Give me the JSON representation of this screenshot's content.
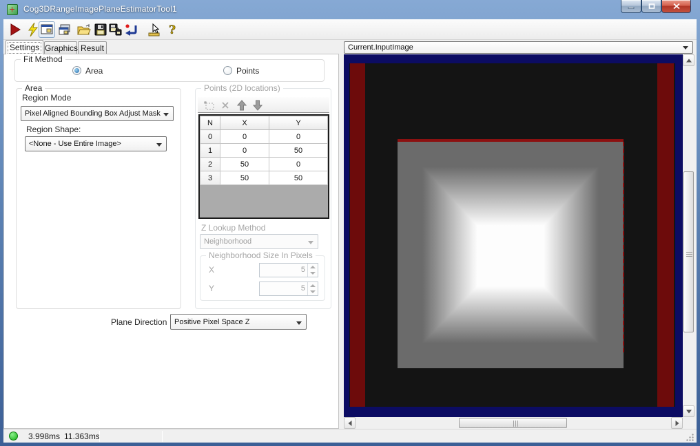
{
  "window": {
    "title": "Cog3DRangeImagePlaneEstimatorTool1"
  },
  "toolbar": {
    "buttons": [
      {
        "name": "run",
        "icon": "run-icon"
      },
      {
        "name": "run-electric",
        "icon": "lightning-icon"
      },
      {
        "name": "show-image-pane",
        "icon": "image-pane-icon",
        "pressed": true
      },
      {
        "name": "float-image-pane",
        "icon": "float-pane-icon",
        "pressed": false
      },
      {
        "name": "open",
        "icon": "open-folder-icon"
      },
      {
        "name": "save",
        "icon": "save-icon"
      },
      {
        "name": "save-as",
        "icon": "save-as-icon"
      },
      {
        "name": "reset",
        "icon": "reset-icon"
      },
      {
        "name": "position-tool",
        "icon": "pointer-ruler-icon"
      },
      {
        "name": "help",
        "icon": "help-icon"
      }
    ]
  },
  "tabs": [
    {
      "label": "Settings",
      "active": true
    },
    {
      "label": "Graphics",
      "active": false
    },
    {
      "label": "Result",
      "active": false
    }
  ],
  "settings": {
    "fit_method": {
      "group_label": "Fit Method",
      "area_option": "Area",
      "points_option": "Points",
      "selected": "Area"
    },
    "area_group": {
      "group_label": "Area",
      "region_mode_label": "Region Mode",
      "region_mode_value": "Pixel Aligned Bounding Box Adjust Mask",
      "region_shape_label": "Region Shape:",
      "region_shape_value": "<None - Use Entire Image>"
    },
    "points_group": {
      "enabled": false,
      "group_label": "Points (2D locations)",
      "toolstrip_icons": [
        "add-point-icon",
        "delete-point-icon",
        "move-up-icon",
        "move-down-icon"
      ],
      "table": {
        "headers": [
          "N",
          "X",
          "Y"
        ],
        "rows": [
          [
            "0",
            "0",
            "0"
          ],
          [
            "1",
            "0",
            "50"
          ],
          [
            "2",
            "50",
            "0"
          ],
          [
            "3",
            "50",
            "50"
          ]
        ]
      },
      "z_lookup_label": "Z Lookup Method",
      "z_lookup_value": "Neighborhood",
      "neighborhood_group": {
        "group_label": "Neighborhood Size In Pixels",
        "x_label": "X",
        "x_value": "5",
        "y_label": "Y",
        "y_value": "5"
      }
    },
    "plane_direction": {
      "label": "Plane Direction",
      "value": "Positive Pixel Space Z"
    }
  },
  "display": {
    "source_selector_value": "Current.InputImage",
    "image": {
      "description": "3D range image: near-black field flanked by dark red vertical bars, containing a gray square with dark red top edge and a truncated-pyramid brightness gradient rising to a white plateau",
      "background_color": "#0c0c63",
      "field_color": "#141414",
      "red_bar_color": "#6d0b0b",
      "gray_square_color": "#6b6b6b",
      "plateau_color": "#fdfdfd",
      "top_edge_color": "#8c1111"
    }
  },
  "status_bar": {
    "indicator": "green-status-led",
    "indicator_color": "#1ecb1e",
    "time1": "3.998ms",
    "time2": "11.363ms"
  }
}
